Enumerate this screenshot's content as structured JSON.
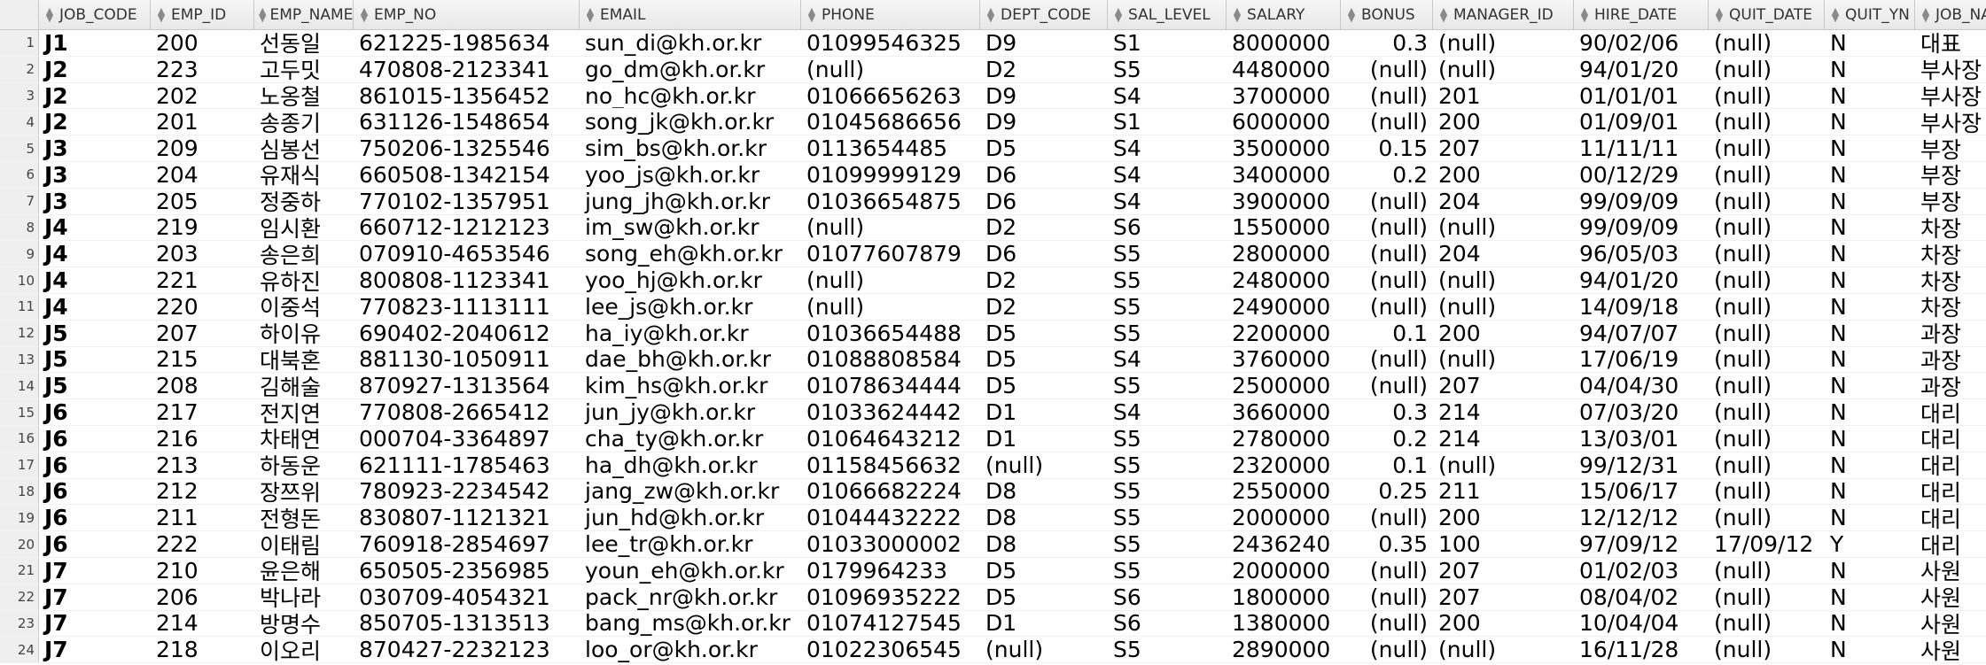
{
  "columns": [
    "JOB_CODE",
    "EMP_ID",
    "EMP_NAME",
    "EMP_NO",
    "EMAIL",
    "PHONE",
    "DEPT_CODE",
    "SAL_LEVEL",
    "SALARY",
    "BONUS",
    "MANAGER_ID",
    "HIRE_DATE",
    "QUIT_DATE",
    "QUIT_YN",
    "JOB_NAME"
  ],
  "sort_icon": "sort-updown-icon",
  "rows": [
    {
      "n": "1",
      "c": [
        "J1",
        "200",
        "선동일",
        "621225-1985634",
        "sun_di@kh.or.kr",
        "01099546325",
        "D9",
        "S1",
        "8000000",
        "0.3",
        "(null)",
        "90/02/06",
        "(null)",
        "N",
        "대표"
      ]
    },
    {
      "n": "2",
      "c": [
        "J2",
        "223",
        "고두밋",
        "470808-2123341",
        "go_dm@kh.or.kr",
        "(null)",
        "D2",
        "S5",
        "4480000",
        "(null)",
        "(null)",
        "94/01/20",
        "(null)",
        "N",
        "부사장"
      ]
    },
    {
      "n": "3",
      "c": [
        "J2",
        "202",
        "노옹철",
        "861015-1356452",
        "no_hc@kh.or.kr",
        "01066656263",
        "D9",
        "S4",
        "3700000",
        "(null)",
        "201",
        "01/01/01",
        "(null)",
        "N",
        "부사장"
      ]
    },
    {
      "n": "4",
      "c": [
        "J2",
        "201",
        "송종기",
        "631126-1548654",
        "song_jk@kh.or.kr",
        "01045686656",
        "D9",
        "S1",
        "6000000",
        "(null)",
        "200",
        "01/09/01",
        "(null)",
        "N",
        "부사장"
      ]
    },
    {
      "n": "5",
      "c": [
        "J3",
        "209",
        "심봉선",
        "750206-1325546",
        "sim_bs@kh.or.kr",
        "0113654485",
        "D5",
        "S4",
        "3500000",
        "0.15",
        "207",
        "11/11/11",
        "(null)",
        "N",
        "부장"
      ]
    },
    {
      "n": "6",
      "c": [
        "J3",
        "204",
        "유재식",
        "660508-1342154",
        "yoo_js@kh.or.kr",
        "01099999129",
        "D6",
        "S4",
        "3400000",
        "0.2",
        "200",
        "00/12/29",
        "(null)",
        "N",
        "부장"
      ]
    },
    {
      "n": "7",
      "c": [
        "J3",
        "205",
        "정중하",
        "770102-1357951",
        "jung_jh@kh.or.kr",
        "01036654875",
        "D6",
        "S4",
        "3900000",
        "(null)",
        "204",
        "99/09/09",
        "(null)",
        "N",
        "부장"
      ]
    },
    {
      "n": "8",
      "c": [
        "J4",
        "219",
        "임시환",
        "660712-1212123",
        "im_sw@kh.or.kr",
        "(null)",
        "D2",
        "S6",
        "1550000",
        "(null)",
        "(null)",
        "99/09/09",
        "(null)",
        "N",
        "차장"
      ]
    },
    {
      "n": "9",
      "c": [
        "J4",
        "203",
        "송은희",
        "070910-4653546",
        "song_eh@kh.or.kr",
        "01077607879",
        "D6",
        "S5",
        "2800000",
        "(null)",
        "204",
        "96/05/03",
        "(null)",
        "N",
        "차장"
      ]
    },
    {
      "n": "10",
      "c": [
        "J4",
        "221",
        "유하진",
        "800808-1123341",
        "yoo_hj@kh.or.kr",
        "(null)",
        "D2",
        "S5",
        "2480000",
        "(null)",
        "(null)",
        "94/01/20",
        "(null)",
        "N",
        "차장"
      ]
    },
    {
      "n": "11",
      "c": [
        "J4",
        "220",
        "이중석",
        "770823-1113111",
        "lee_js@kh.or.kr",
        "(null)",
        "D2",
        "S5",
        "2490000",
        "(null)",
        "(null)",
        "14/09/18",
        "(null)",
        "N",
        "차장"
      ]
    },
    {
      "n": "12",
      "c": [
        "J5",
        "207",
        "하이유",
        "690402-2040612",
        "ha_iy@kh.or.kr",
        "01036654488",
        "D5",
        "S5",
        "2200000",
        "0.1",
        "200",
        "94/07/07",
        "(null)",
        "N",
        "과장"
      ]
    },
    {
      "n": "13",
      "c": [
        "J5",
        "215",
        "대북혼",
        "881130-1050911",
        "dae_bh@kh.or.kr",
        "01088808584",
        "D5",
        "S4",
        "3760000",
        "(null)",
        "(null)",
        "17/06/19",
        "(null)",
        "N",
        "과장"
      ]
    },
    {
      "n": "14",
      "c": [
        "J5",
        "208",
        "김해술",
        "870927-1313564",
        "kim_hs@kh.or.kr",
        "01078634444",
        "D5",
        "S5",
        "2500000",
        "(null)",
        "207",
        "04/04/30",
        "(null)",
        "N",
        "과장"
      ]
    },
    {
      "n": "15",
      "c": [
        "J6",
        "217",
        "전지연",
        "770808-2665412",
        "jun_jy@kh.or.kr",
        "01033624442",
        "D1",
        "S4",
        "3660000",
        "0.3",
        "214",
        "07/03/20",
        "(null)",
        "N",
        "대리"
      ]
    },
    {
      "n": "16",
      "c": [
        "J6",
        "216",
        "차태연",
        "000704-3364897",
        "cha_ty@kh.or.kr",
        "01064643212",
        "D1",
        "S5",
        "2780000",
        "0.2",
        "214",
        "13/03/01",
        "(null)",
        "N",
        "대리"
      ]
    },
    {
      "n": "17",
      "c": [
        "J6",
        "213",
        "하동운",
        "621111-1785463",
        "ha_dh@kh.or.kr",
        "01158456632",
        "(null)",
        "S5",
        "2320000",
        "0.1",
        "(null)",
        "99/12/31",
        "(null)",
        "N",
        "대리"
      ]
    },
    {
      "n": "18",
      "c": [
        "J6",
        "212",
        "장쯔위",
        "780923-2234542",
        "jang_zw@kh.or.kr",
        "01066682224",
        "D8",
        "S5",
        "2550000",
        "0.25",
        "211",
        "15/06/17",
        "(null)",
        "N",
        "대리"
      ]
    },
    {
      "n": "19",
      "c": [
        "J6",
        "211",
        "전형돈",
        "830807-1121321",
        "jun_hd@kh.or.kr",
        "01044432222",
        "D8",
        "S5",
        "2000000",
        "(null)",
        "200",
        "12/12/12",
        "(null)",
        "N",
        "대리"
      ]
    },
    {
      "n": "20",
      "c": [
        "J6",
        "222",
        "이태림",
        "760918-2854697",
        "lee_tr@kh.or.kr",
        "01033000002",
        "D8",
        "S5",
        "2436240",
        "0.35",
        "100",
        "97/09/12",
        "17/09/12",
        "Y",
        "대리"
      ]
    },
    {
      "n": "21",
      "c": [
        "J7",
        "210",
        "윤은해",
        "650505-2356985",
        "youn_eh@kh.or.kr",
        "0179964233",
        "D5",
        "S5",
        "2000000",
        "(null)",
        "207",
        "01/02/03",
        "(null)",
        "N",
        "사원"
      ]
    },
    {
      "n": "22",
      "c": [
        "J7",
        "206",
        "박나라",
        "030709-4054321",
        "pack_nr@kh.or.kr",
        "01096935222",
        "D5",
        "S6",
        "1800000",
        "(null)",
        "207",
        "08/04/02",
        "(null)",
        "N",
        "사원"
      ]
    },
    {
      "n": "23",
      "c": [
        "J7",
        "214",
        "방명수",
        "850705-1313513",
        "bang_ms@kh.or.kr",
        "01074127545",
        "D1",
        "S6",
        "1380000",
        "(null)",
        "200",
        "10/04/04",
        "(null)",
        "N",
        "사원"
      ]
    },
    {
      "n": "24",
      "c": [
        "J7",
        "218",
        "이오리",
        "870427-2232123",
        "loo_or@kh.or.kr",
        "01022306545",
        "(null)",
        "S5",
        "2890000",
        "(null)",
        "(null)",
        "16/11/28",
        "(null)",
        "N",
        "사원"
      ]
    }
  ]
}
